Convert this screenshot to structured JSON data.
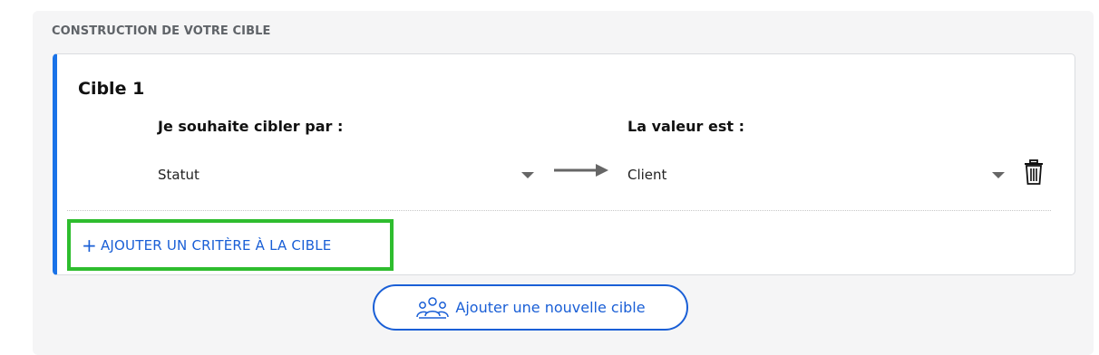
{
  "section": {
    "title": "CONSTRUCTION DE VOTRE CIBLE"
  },
  "target_card": {
    "title": "Cible 1",
    "criterion_label": "Je souhaite cibler par :",
    "value_label": "La valeur est :",
    "criterion_selected": "Statut",
    "value_selected": "Client",
    "add_criterion_label": "AJOUTER UN CRITÈRE À LA CIBLE",
    "add_criterion_plus": "+"
  },
  "actions": {
    "new_target_label": "Ajouter une nouvelle cible"
  },
  "icons": {
    "arrow": "arrow-right-icon",
    "caret": "chevron-down-icon",
    "trash": "trash-icon",
    "group": "users-group-icon"
  },
  "colors": {
    "accent": "#1a73e8",
    "link": "#1a5fd6",
    "highlight": "#2ebd2e"
  }
}
